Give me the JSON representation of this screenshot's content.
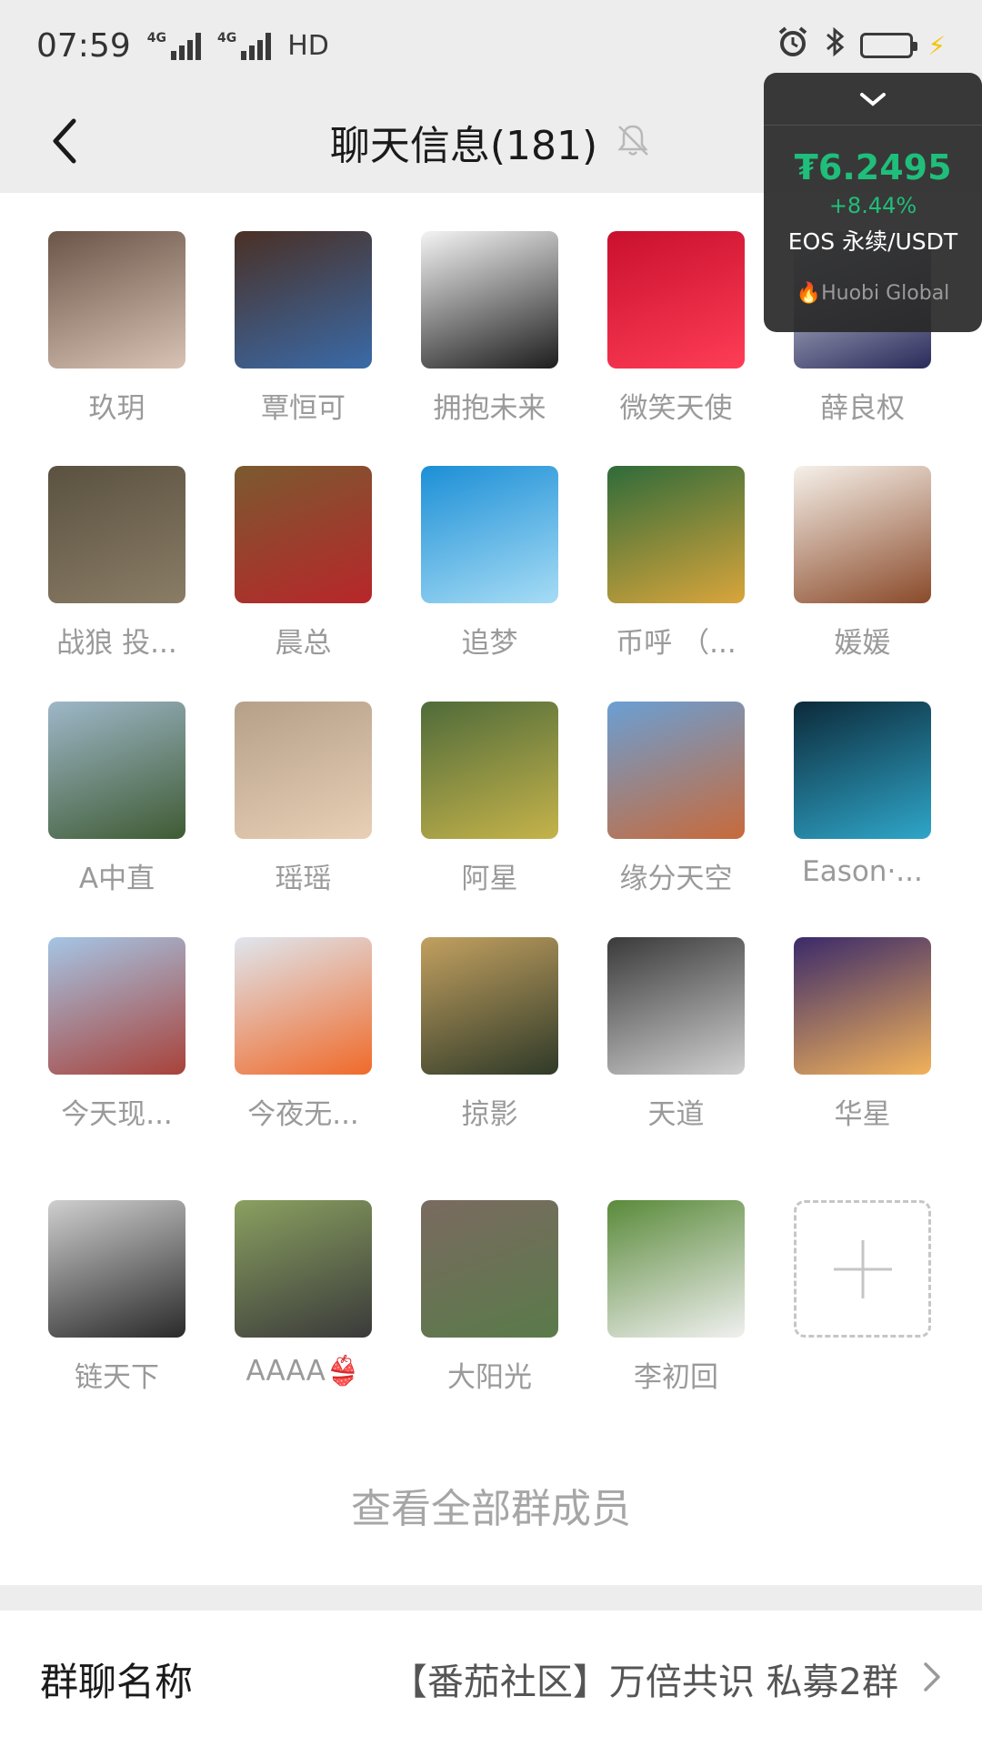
{
  "status_bar": {
    "time": "07:59",
    "network1": "4G",
    "network2": "4G",
    "hd": "HD"
  },
  "header": {
    "title": "聊天信息(181)",
    "back_icon": "chevron-left-icon",
    "mute_icon": "bell-off-icon"
  },
  "ticker": {
    "price": "₮6.2495",
    "change": "+8.44%",
    "pair": "EOS 永续/USDT",
    "brand": "Huobi Global",
    "accent_color": "#1fbe7a"
  },
  "members": [
    {
      "name": "玖玥",
      "color1": "#6b5548",
      "color2": "#d8c2b4"
    },
    {
      "name": "覃恒可",
      "color1": "#4a3025",
      "color2": "#3a6aa8"
    },
    {
      "name": "拥抱未来",
      "color1": "#f4f4f4",
      "color2": "#1d1d1d"
    },
    {
      "name": "微笑天使",
      "color1": "#c8102e",
      "color2": "#ff3d56"
    },
    {
      "name": "薛良权",
      "color1": "#e8eef5",
      "color2": "#2a2a5a"
    },
    {
      "name": "战狼 投...",
      "color1": "#5a5140",
      "color2": "#8a7d66"
    },
    {
      "name": "晨总",
      "color1": "#7a5a30",
      "color2": "#b8262a"
    },
    {
      "name": "追梦",
      "color1": "#1c8fd6",
      "color2": "#a6dcf5"
    },
    {
      "name": "币呼 （...",
      "color1": "#2f6b3a",
      "color2": "#d9a53b"
    },
    {
      "name": "媛媛",
      "color1": "#f6f1ea",
      "color2": "#8a4a2a"
    },
    {
      "name": "A中直",
      "color1": "#9eb7c9",
      "color2": "#3f5b33"
    },
    {
      "name": "瑶瑶",
      "color1": "#b5a088",
      "color2": "#e8cfb6"
    },
    {
      "name": "阿星",
      "color1": "#4f6b3a",
      "color2": "#c5b34a"
    },
    {
      "name": "缘分天空",
      "color1": "#6a9fd4",
      "color2": "#c86a3a"
    },
    {
      "name": "Eason·...",
      "color1": "#0c2a3a",
      "color2": "#2fa6c9"
    },
    {
      "name": "今天现...",
      "color1": "#a5c5e5",
      "color2": "#a8423a"
    },
    {
      "name": "今夜无...",
      "color1": "#dfe6ee",
      "color2": "#f06a2a"
    },
    {
      "name": "掠影",
      "color1": "#c2a060",
      "color2": "#2f3a28"
    },
    {
      "name": "天道",
      "color1": "#3a3a3a",
      "color2": "#cfcfcf"
    },
    {
      "name": "华星",
      "color1": "#3a2a6a",
      "color2": "#f2b25a"
    },
    {
      "name": "链天下",
      "color1": "#cfcfcf",
      "color2": "#2a2a2a"
    },
    {
      "name": "AAAA👙",
      "color1": "#8aa060",
      "color2": "#3a3a3a"
    },
    {
      "name": "大阳光",
      "color1": "#7a6a60",
      "color2": "#5a7a4a"
    },
    {
      "name": "李初回",
      "color1": "#5a8a3a",
      "color2": "#f0f0f0"
    }
  ],
  "add_member_icon": "plus-icon",
  "view_all_label": "查看全部群成员",
  "group_name": {
    "label": "群聊名称",
    "value": "【番茄社区】万倍共识 私募2群",
    "chevron_icon": "chevron-right-icon"
  }
}
